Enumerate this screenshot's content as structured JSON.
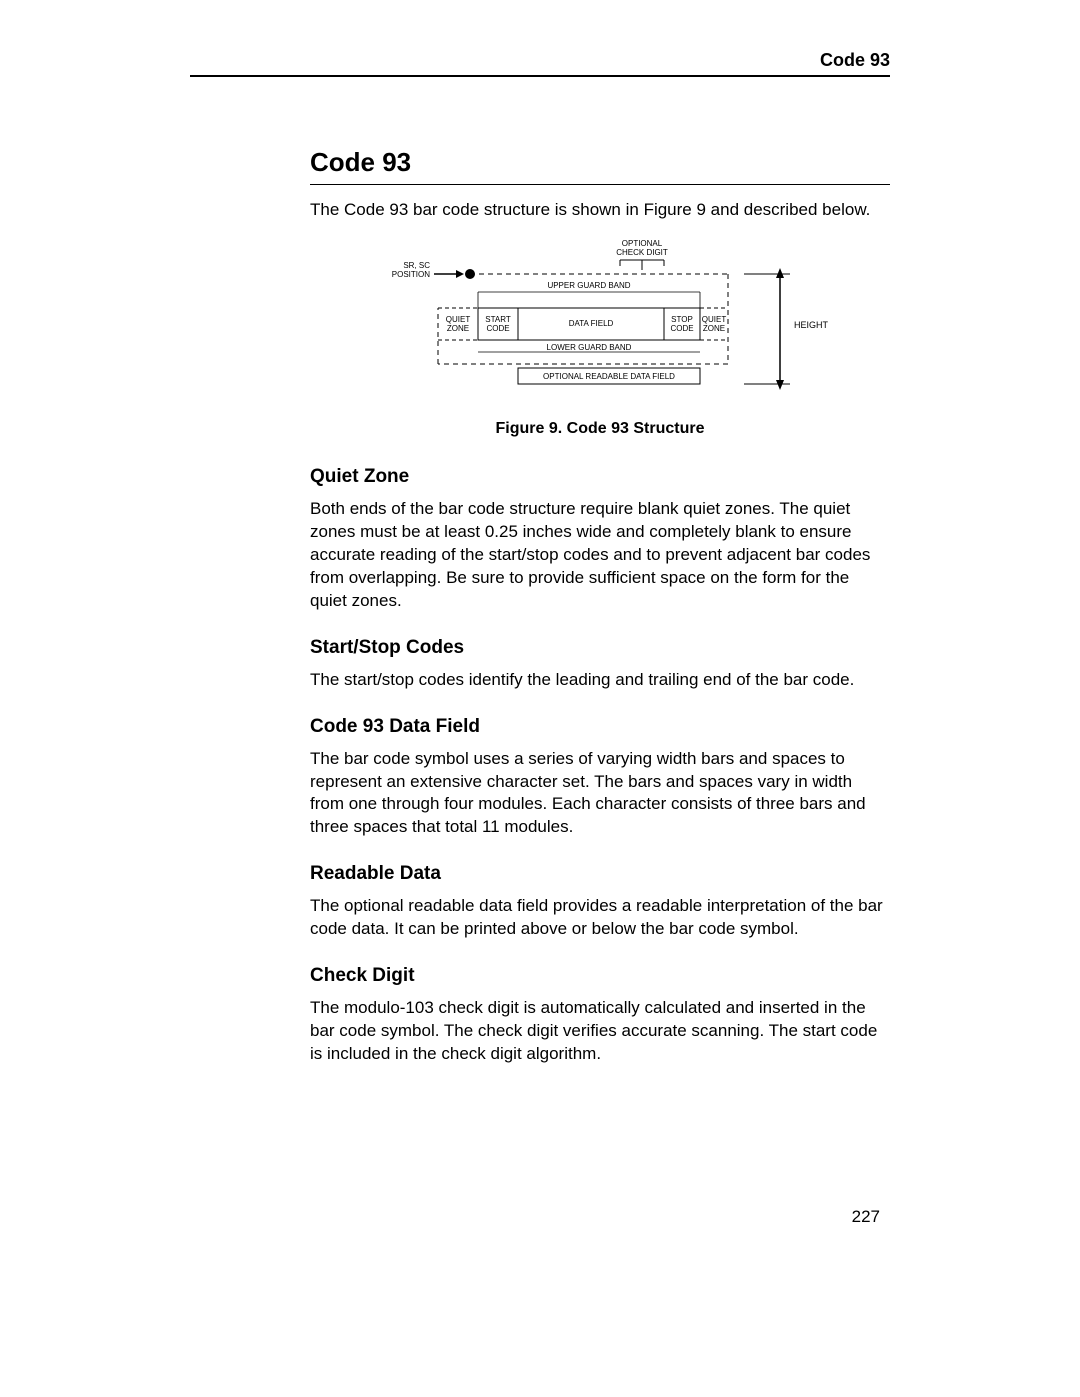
{
  "header": {
    "running_head": "Code 93"
  },
  "title": "Code 93",
  "intro": "The Code 93 bar code structure is shown in Figure 9 and described below.",
  "figure": {
    "caption": "Figure 9. Code 93 Structure",
    "labels": {
      "sr_sc_1": "SR, SC",
      "sr_sc_2": "POSITION",
      "optional_cd_1": "OPTIONAL",
      "optional_cd_2": "CHECK DIGIT",
      "upper_guard": "UPPER GUARD BAND",
      "quiet_zone_l_1": "QUIET",
      "quiet_zone_l_2": "ZONE",
      "start_code_1": "START",
      "start_code_2": "CODE",
      "data_field": "DATA FIELD",
      "stop_code_1": "STOP",
      "stop_code_2": "CODE",
      "quiet_zone_r_1": "QUIET",
      "quiet_zone_r_2": "ZONE",
      "lower_guard": "LOWER GUARD BAND",
      "readable": "OPTIONAL READABLE DATA FIELD",
      "height": "HEIGHT"
    }
  },
  "sections": {
    "quiet_zone": {
      "heading": "Quiet Zone",
      "body": "Both ends of the bar code structure require blank quiet zones. The quiet zones must be at least 0.25 inches wide and completely blank to ensure accurate reading of the start/stop codes and to prevent adjacent bar codes from overlapping. Be sure to provide sufficient space on the form for the quiet zones."
    },
    "start_stop": {
      "heading": "Start/Stop Codes",
      "body": "The start/stop codes identify the leading and trailing end of the bar code."
    },
    "data_field": {
      "heading": "Code 93 Data Field",
      "body": "The bar code symbol uses a series of varying width bars and spaces to represent an extensive character set. The bars and spaces vary in width from one through four modules. Each character consists of three bars and three spaces that total 11 modules."
    },
    "readable_data": {
      "heading": "Readable Data",
      "body": "The optional readable data field provides a readable interpretation of the bar code data. It can be printed above or below the bar code symbol."
    },
    "check_digit": {
      "heading": "Check Digit",
      "body": "The modulo-103 check digit is automatically calculated and inserted in the bar code symbol. The check digit verifies accurate scanning. The start code is included in the check digit algorithm."
    }
  },
  "page_number": "227"
}
